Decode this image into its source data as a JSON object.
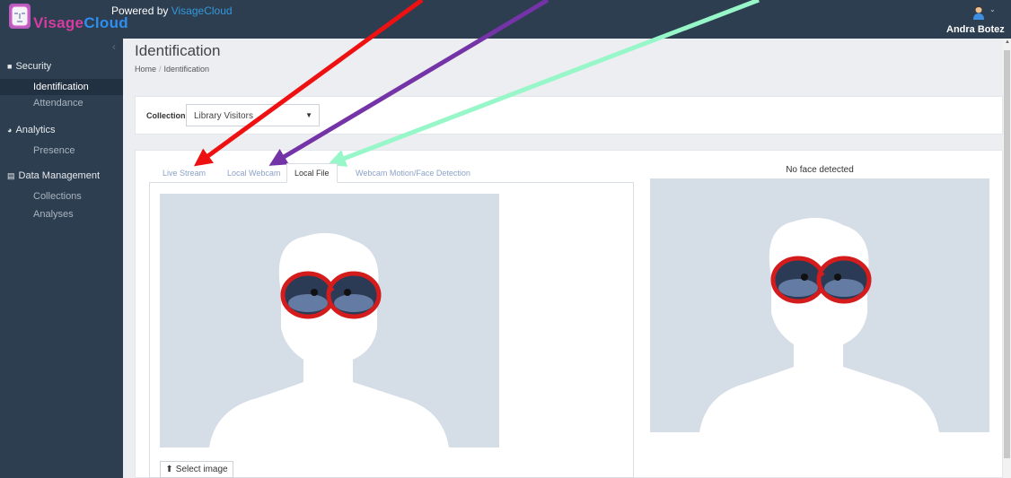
{
  "app": {
    "logo_text_a": "Visage",
    "logo_text_b": "Cloud",
    "powered_prefix": "Powered by",
    "powered_link": "VisageCloud"
  },
  "user": {
    "name": "Andra Botez",
    "icon": "user-avatar-icon"
  },
  "sidebar": {
    "groups": [
      {
        "label": "Security",
        "icon": "camera-icon"
      },
      {
        "label": "Analytics",
        "icon": "pie-chart-icon"
      },
      {
        "label": "Data Management",
        "icon": "list-icon"
      }
    ],
    "items": [
      "Identification",
      "Attendance",
      "Presence",
      "Collections",
      "Analyses"
    ]
  },
  "page": {
    "title": "Identification",
    "breadcrumb": [
      "Home",
      "Identification"
    ]
  },
  "collection": {
    "label": "Collection",
    "selected": "Library Visitors"
  },
  "tabs": [
    "Live Stream",
    "Local Webcam",
    "Local File",
    "Webcam Motion/Face Detection"
  ],
  "active_tab": "Local File",
  "result": {
    "status": "No face detected"
  },
  "upload": {
    "button_label": "Select image",
    "icon": "upload-icon"
  },
  "colors": {
    "topbar": "#2c3e50",
    "sidebar": "#2c3e50",
    "placeholder_bg": "#d5dde7",
    "arrow_red": "#ee1111",
    "arrow_purple": "#7433a6",
    "arrow_mint": "#97f7c9"
  }
}
